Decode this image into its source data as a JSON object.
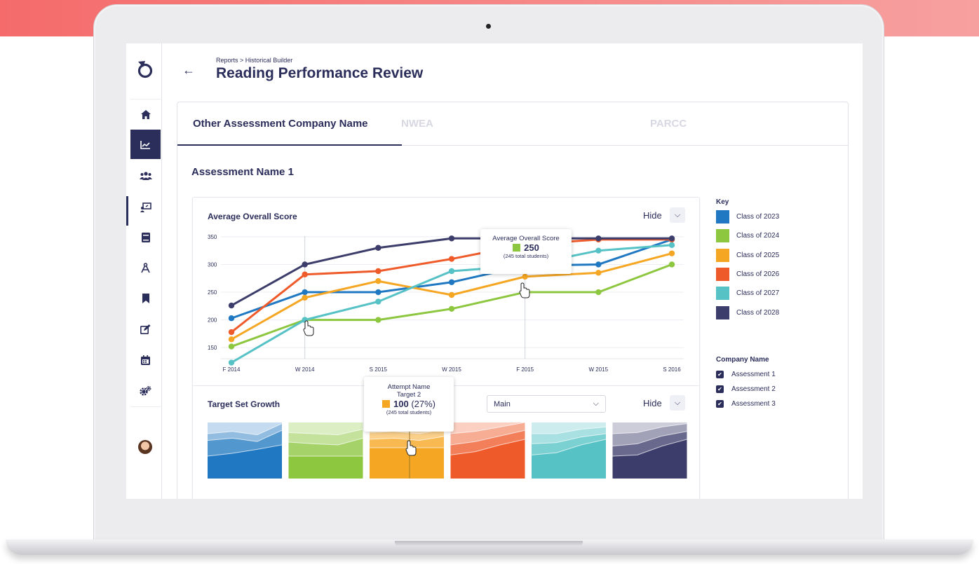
{
  "breadcrumb": "Reports > Historical Builder",
  "page_title": "Reading Performance Review",
  "tabs": [
    {
      "label": "Other Assessment Company Name",
      "active": true
    },
    {
      "label": "NWEA",
      "active": false
    },
    {
      "label": "PARCC",
      "active": false
    }
  ],
  "section_title": "Assessment Name 1",
  "sidebar": {
    "items": [
      {
        "icon": "home-icon"
      },
      {
        "icon": "trend-chart-icon",
        "active": true
      },
      {
        "icon": "users-icon"
      },
      {
        "icon": "presentation-icon"
      },
      {
        "icon": "book-icon"
      },
      {
        "icon": "compass-icon"
      },
      {
        "icon": "bookmark-icon"
      },
      {
        "icon": "edit-icon"
      },
      {
        "icon": "calendar-icon"
      },
      {
        "icon": "settings-icon"
      }
    ]
  },
  "line_chart_card": {
    "title": "Average Overall Score",
    "hide_label": "Hide",
    "tooltip": {
      "title": "Average Overall Score",
      "value": "250",
      "sub": "(245 total students)",
      "color": "#8dc63f"
    }
  },
  "growth_card": {
    "title": "Target Set Growth",
    "hide_label": "Hide",
    "select_value": "Main",
    "tooltip": {
      "line1": "Attempt Name",
      "line2": "Target 2",
      "value": "100",
      "pct": "(27%)",
      "sub": "(245 total students)",
      "color": "#f5a623"
    }
  },
  "legend": {
    "title": "Key",
    "items": [
      {
        "label": "Class of 2023",
        "color": "#1f78c1"
      },
      {
        "label": "Class of 2024",
        "color": "#8dc63f"
      },
      {
        "label": "Class of 2025",
        "color": "#f5a623"
      },
      {
        "label": "Class of 2026",
        "color": "#ef5a2a"
      },
      {
        "label": "Class of 2027",
        "color": "#56c2c6"
      },
      {
        "label": "Class of 2028",
        "color": "#3d3d6b"
      }
    ],
    "company_title": "Company Name",
    "company_items": [
      {
        "label": "Assessment 1",
        "checked": true
      },
      {
        "label": "Assessment 2",
        "checked": true
      },
      {
        "label": "Assessment 3",
        "checked": true
      }
    ]
  },
  "chart_data": [
    {
      "type": "line",
      "title": "Average Overall Score",
      "x": [
        "F 2014",
        "W 2014",
        "S 2015",
        "W 2015",
        "F 2015",
        "W 2015",
        "S 2016"
      ],
      "yticks": [
        150,
        200,
        250,
        300,
        350
      ],
      "ylim": [
        130,
        360
      ],
      "grid": true,
      "series": [
        {
          "name": "Class of 2023",
          "color": "#1f78c1",
          "values": [
            203,
            250,
            250,
            268,
            298,
            300,
            345
          ]
        },
        {
          "name": "Class of 2024",
          "color": "#8dc63f",
          "values": [
            152,
            200,
            200,
            220,
            250,
            250,
            300
          ]
        },
        {
          "name": "Class of 2025",
          "color": "#f5a623",
          "values": [
            165,
            240,
            270,
            245,
            278,
            285,
            320
          ]
        },
        {
          "name": "Class of 2026",
          "color": "#ef5a2a",
          "values": [
            178,
            282,
            288,
            310,
            336,
            345,
            345
          ]
        },
        {
          "name": "Class of 2027",
          "color": "#56c2c6",
          "values": [
            123,
            200,
            233,
            288,
            298,
            325,
            335
          ]
        },
        {
          "name": "Class of 2028",
          "color": "#3d3d6b",
          "values": [
            226,
            300,
            330,
            347,
            347,
            347,
            347
          ]
        }
      ]
    },
    {
      "type": "area",
      "title": "Target Set Growth",
      "panels": [
        {
          "color": "#1f78c1",
          "light": "#c5dbef",
          "layers": [
            [
              0.4,
              0.45,
              0.52,
              0.6
            ],
            [
              0.68,
              0.72,
              0.66,
              0.86
            ],
            [
              0.8,
              0.84,
              0.78,
              0.98
            ]
          ]
        },
        {
          "color": "#8dc63f",
          "light": "#dbeec4",
          "layers": [
            [
              0.4,
              0.4,
              0.4,
              0.4
            ],
            [
              0.65,
              0.62,
              0.6,
              0.72
            ],
            [
              0.82,
              0.8,
              0.78,
              0.88
            ]
          ]
        },
        {
          "color": "#f5a623",
          "light": "#fce3b8",
          "layers": [
            [
              0.55,
              0.55,
              0.55,
              0.55
            ],
            [
              0.7,
              0.72,
              0.68,
              0.75
            ],
            [
              0.82,
              0.84,
              0.8,
              0.88
            ]
          ]
        },
        {
          "color": "#ef5a2a",
          "light": "#fbd0c2",
          "layers": [
            [
              0.42,
              0.48,
              0.6,
              0.7
            ],
            [
              0.6,
              0.66,
              0.76,
              0.86
            ],
            [
              0.8,
              0.84,
              0.92,
              1.0
            ]
          ]
        },
        {
          "color": "#56c2c6",
          "light": "#cdeced",
          "layers": [
            [
              0.42,
              0.46,
              0.6,
              0.7
            ],
            [
              0.62,
              0.64,
              0.74,
              0.8
            ],
            [
              0.8,
              0.8,
              0.88,
              0.92
            ]
          ]
        },
        {
          "color": "#3d3d6b",
          "light": "#cdcdda",
          "layers": [
            [
              0.4,
              0.42,
              0.58,
              0.7
            ],
            [
              0.58,
              0.62,
              0.76,
              0.84
            ],
            [
              0.8,
              0.82,
              0.92,
              0.98
            ]
          ]
        }
      ]
    }
  ]
}
